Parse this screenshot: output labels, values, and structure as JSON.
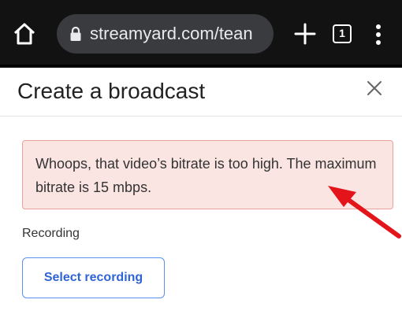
{
  "browser": {
    "url": "streamyard.com/tean",
    "tab_count": "1"
  },
  "dialog": {
    "title": "Create a broadcast",
    "error_message": "Whoops, that video’s bitrate is too high. The maximum bitrate is 15 mbps.",
    "recording_label": "Recording",
    "select_button_label": "Select recording"
  },
  "colors": {
    "browser_bar": "#121212",
    "url_pill": "#3a3b3f",
    "alert_background": "#fbe5e2",
    "alert_border": "#e9a19a",
    "button_text": "#2f64d6",
    "annotation_arrow": "#e3141a"
  },
  "icons": {
    "home": "home-icon",
    "lock": "lock-icon",
    "new_tab": "plus-icon",
    "tabs": "tabs-icon",
    "menu": "more-vert-icon",
    "close": "close-icon",
    "annotation": "red-arrow-annotation"
  }
}
